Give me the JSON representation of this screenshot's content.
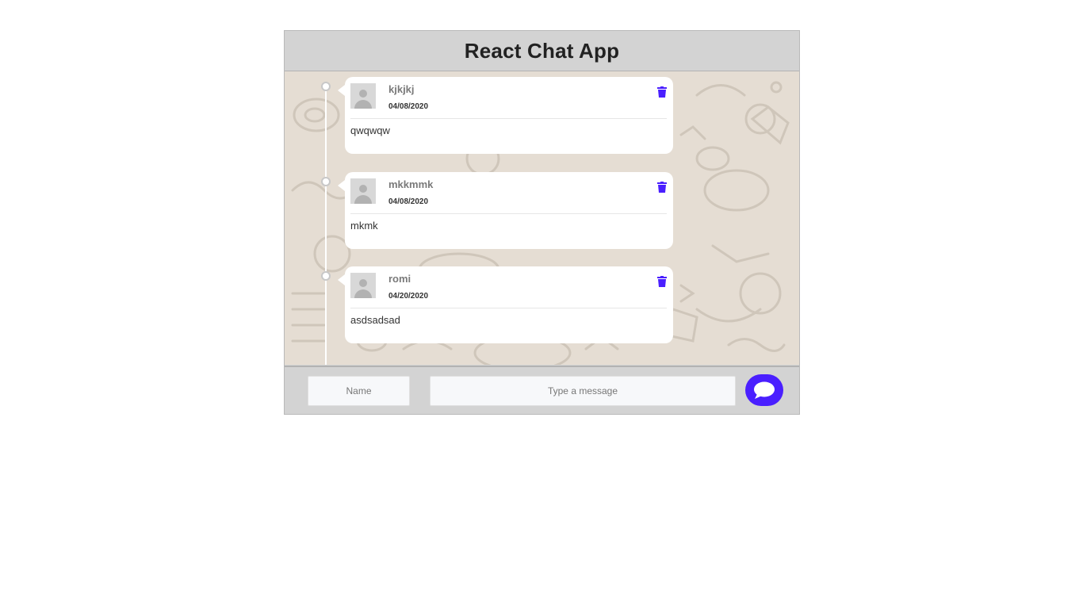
{
  "header": {
    "title": "React Chat App"
  },
  "messages": [
    {
      "name": "kjkjkj",
      "date": "04/08/2020",
      "text": "qwqwqw"
    },
    {
      "name": "mkkmmk",
      "date": "04/08/2020",
      "text": "mkmk"
    },
    {
      "name": "romi",
      "date": "04/20/2020",
      "text": "asdsadsad"
    }
  ],
  "footer": {
    "name_placeholder": "Name",
    "message_placeholder": "Type a message"
  },
  "icons": {
    "delete": "trash-icon",
    "send": "chat-bubble-icon",
    "avatar": "user-placeholder-icon"
  },
  "colors": {
    "accent": "#4a1fff",
    "header_bg": "#d3d3d3",
    "chat_bg": "#e5ddd3",
    "card_bg": "#ffffff"
  }
}
